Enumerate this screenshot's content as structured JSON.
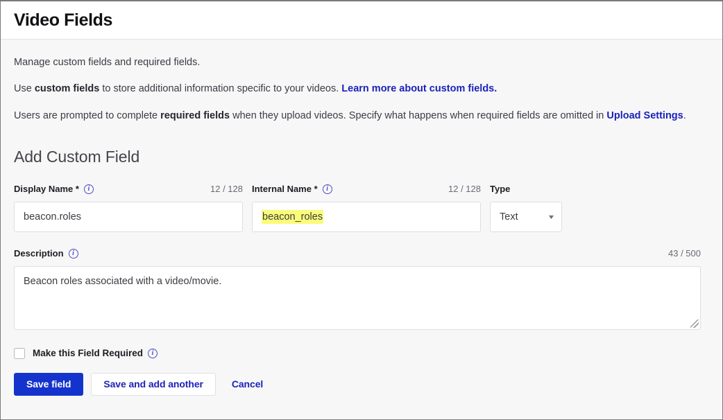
{
  "header": {
    "title": "Video Fields"
  },
  "intro": {
    "p1": "Manage custom fields and required fields.",
    "p2_before": "Use ",
    "p2_bold": "custom fields",
    "p2_after": " to store additional information specific to your videos. ",
    "p2_link": "Learn more about custom fields.",
    "p3_before": "Users are prompted to complete ",
    "p3_bold": "required fields",
    "p3_mid": " when they upload videos. Specify what happens when required fields are omitted in ",
    "p3_link": "Upload Settings",
    "p3_end": "."
  },
  "section": {
    "title": "Add Custom Field"
  },
  "form": {
    "display_name": {
      "label": "Display Name *",
      "counter": "12 / 128",
      "value": "beacon.roles",
      "placeholder": ""
    },
    "internal_name": {
      "label": "Internal Name *",
      "counter": "12 / 128",
      "value": "beacon_roles",
      "placeholder": "",
      "highlighted": true
    },
    "type": {
      "label": "Type",
      "value": "Text",
      "caret": "▼",
      "options": [
        "Text"
      ]
    },
    "description": {
      "label": "Description",
      "counter": "43 / 500",
      "value": "Beacon roles associated with a video/movie.",
      "placeholder": ""
    },
    "required_checkbox": {
      "label": "Make this Field Required",
      "checked": false
    },
    "info_glyph": "i"
  },
  "buttons": {
    "save": "Save field",
    "save_add_another": "Save and add another",
    "cancel": "Cancel"
  },
  "colors": {
    "primary": "#1433cc",
    "link": "#1a22b8",
    "highlight": "#fbfb7a",
    "page_bg": "#f7f7f8",
    "info_icon": "#4a4ec2"
  }
}
